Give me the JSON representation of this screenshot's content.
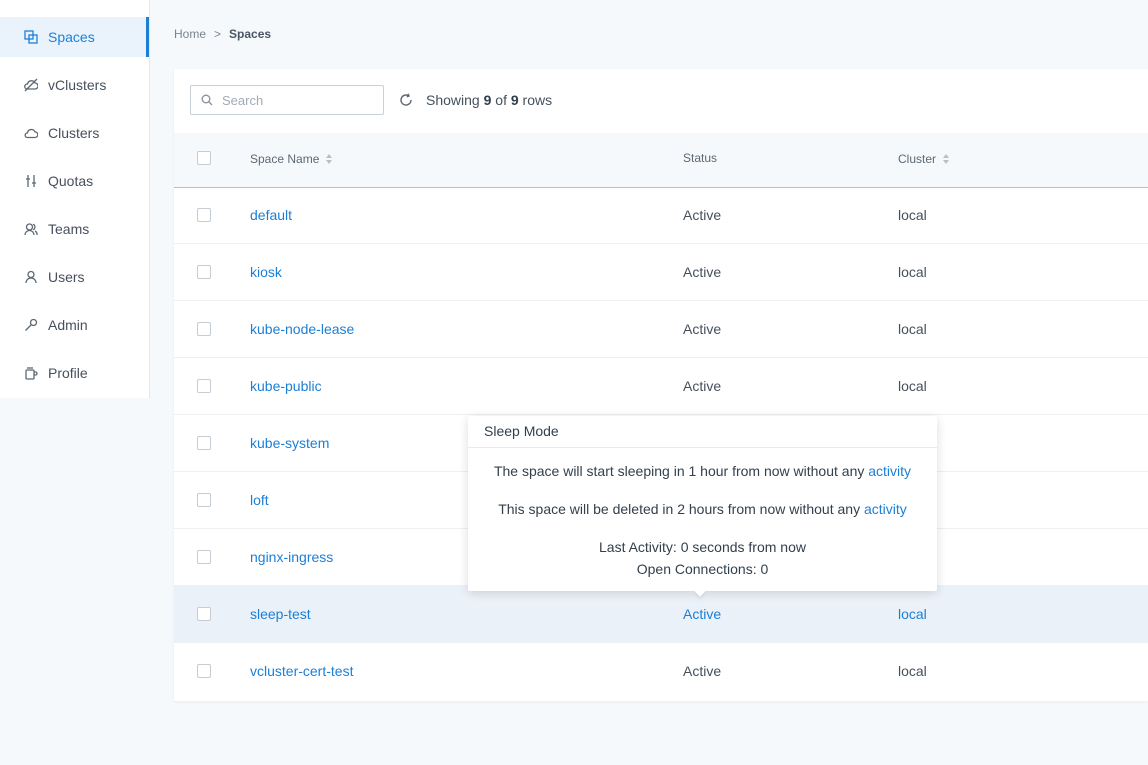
{
  "sidebar": {
    "items": [
      {
        "label": "Spaces",
        "icon": "spaces-icon"
      },
      {
        "label": "vClusters",
        "icon": "vclusters-icon"
      },
      {
        "label": "Clusters",
        "icon": "clusters-icon"
      },
      {
        "label": "Quotas",
        "icon": "quotas-icon"
      },
      {
        "label": "Teams",
        "icon": "teams-icon"
      },
      {
        "label": "Users",
        "icon": "users-icon"
      },
      {
        "label": "Admin",
        "icon": "admin-icon"
      },
      {
        "label": "Profile",
        "icon": "profile-icon"
      }
    ],
    "active": "Spaces"
  },
  "breadcrumb": {
    "home": "Home",
    "separator": ">",
    "current": "Spaces"
  },
  "toolbar": {
    "search_placeholder": "Search",
    "showing_prefix": "Showing",
    "shown": "9",
    "of": "of",
    "total": "9",
    "suffix": "rows"
  },
  "table": {
    "columns": {
      "name": "Space Name",
      "status": "Status",
      "cluster": "Cluster"
    },
    "rows": [
      {
        "name": "default",
        "status": "Active",
        "cluster": "local"
      },
      {
        "name": "kiosk",
        "status": "Active",
        "cluster": "local"
      },
      {
        "name": "kube-node-lease",
        "status": "Active",
        "cluster": "local"
      },
      {
        "name": "kube-public",
        "status": "Active",
        "cluster": "local"
      },
      {
        "name": "kube-system",
        "status": "",
        "cluster": ""
      },
      {
        "name": "loft",
        "status": "",
        "cluster": ""
      },
      {
        "name": "nginx-ingress",
        "status": "",
        "cluster": ""
      },
      {
        "name": "sleep-test",
        "status": "Active",
        "cluster": "local"
      },
      {
        "name": "vcluster-cert-test",
        "status": "Active",
        "cluster": "local"
      }
    ],
    "highlighted_row": "sleep-test"
  },
  "tooltip": {
    "title": "Sleep Mode",
    "line1_text": "The space will start sleeping in 1 hour from now without any ",
    "line1_link": "activity",
    "line2_text": "This space will be deleted in 2 hours from now without any ",
    "line2_link": "activity",
    "last_activity": "Last Activity: 0 seconds from now",
    "open_connections": "Open Connections: 0"
  },
  "colors": {
    "accent": "#1c7fd6",
    "highlight_row": "#ebf1f8",
    "sidebar_active_bg": "#eaf3fc"
  }
}
